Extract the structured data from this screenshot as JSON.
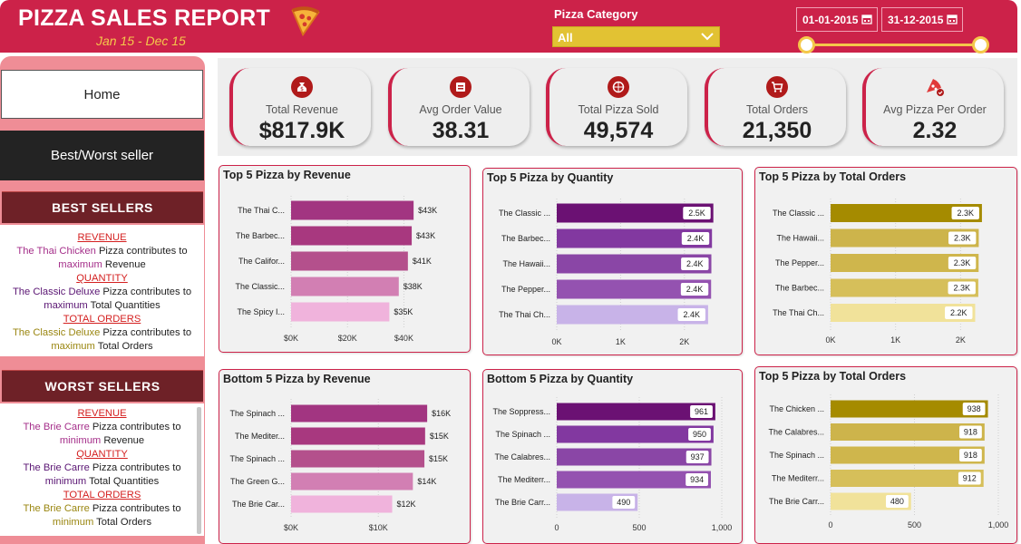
{
  "header": {
    "title": "PIZZA SALES REPORT",
    "subtitle": "Jan 15 - Dec 15",
    "category_label": "Pizza Category",
    "category_value": "All",
    "date_start": "01-01-2015",
    "date_end": "31-12-2015"
  },
  "nav": {
    "home": "Home",
    "best_worst": "Best/Worst seller"
  },
  "best": {
    "heading": "BEST SELLERS",
    "revenue_label": "REVENUE",
    "revenue_name": "The Thai Chicken",
    "revenue_tail": " Pizza contributes to",
    "revenue_l2_a": "maximum",
    "revenue_l2_b": " Revenue",
    "qty_label": "QUANTITY",
    "qty_name": "The Classic Deluxe",
    "qty_tail": " Pizza contributes to",
    "qty_l2_a": "maximum",
    "qty_l2_b": " Total Quantities",
    "orders_label": "TOTAL ORDERS",
    "orders_name": "The Classic Deluxe",
    "orders_tail": " Pizza contributes to",
    "orders_l2_a": "maximum",
    "orders_l2_b": " Total Orders"
  },
  "worst": {
    "heading": "WORST SELLERS",
    "revenue_label": "REVENUE",
    "revenue_name": "The Brie Carre",
    "revenue_tail": " Pizza contributes to",
    "revenue_l2_a": "minimum",
    "revenue_l2_b": " Revenue",
    "qty_label": "QUANTITY",
    "qty_name": "The Brie Carre",
    "qty_tail": "  Pizza contributes to",
    "qty_l2_a": "minimum",
    "qty_l2_b": " Total Quantities",
    "orders_label": "TOTAL ORDERS",
    "orders_name": "The Brie Carre",
    "orders_tail": " Pizza contributes to",
    "orders_l2_a": "minimum",
    "orders_l2_b": " Total Orders"
  },
  "kpis": [
    {
      "label": "Total Revenue",
      "value": "$817.9K",
      "icon": "money-bag-icon"
    },
    {
      "label": "Avg Order Value",
      "value": "38.31",
      "icon": "sale-tag-icon"
    },
    {
      "label": "Total Pizza Sold",
      "value": "49,574",
      "icon": "pizza-icon"
    },
    {
      "label": "Total Orders",
      "value": "21,350",
      "icon": "shopping-cart-icon"
    },
    {
      "label": "Avg Pizza Per Order",
      "value": "2.32",
      "icon": "pizza-slices-icon"
    }
  ],
  "colors": {
    "brand": "#cc2249",
    "revenue_palette": [
      "#a23581",
      "#a8387f",
      "#b4508c",
      "#d27fb3",
      "#f0b3dc"
    ],
    "quantity_palette": [
      "#6b1173",
      "#8238a0",
      "#8a46a6",
      "#9452b0",
      "#c8b3e8"
    ],
    "orders_palette": [
      "#a58b00",
      "#cdb44b",
      "#cfb64c",
      "#d6bf5a",
      "#f1e29a"
    ]
  },
  "chart_data": [
    {
      "type": "bar",
      "title": "Top 5 Pizza by Revenue",
      "categories": [
        "The Thai C...",
        "The Barbec...",
        "The Califor...",
        "The Classic...",
        "The Spicy I..."
      ],
      "values": [
        43434,
        42768,
        41410,
        38181,
        34831
      ],
      "labels": [
        "$43K",
        "$43K",
        "$41K",
        "$38K",
        "$35K"
      ],
      "xlim": [
        0,
        45000
      ],
      "ticks": [
        0,
        20000,
        40000
      ],
      "tick_labels": [
        "$0K",
        "$20K",
        "$40K"
      ],
      "palette": "revenue_palette",
      "label_style": "plain"
    },
    {
      "type": "bar",
      "title": "Top 5 Pizza by Quantity",
      "categories": [
        "The Classic ...",
        "The Barbec...",
        "The Hawaii...",
        "The Pepper...",
        "The Thai Ch..."
      ],
      "values": [
        2453,
        2432,
        2422,
        2418,
        2371
      ],
      "labels": [
        "2.5K",
        "2.4K",
        "2.4K",
        "2.4K",
        "2.4K"
      ],
      "xlim": [
        0,
        2500
      ],
      "ticks": [
        0,
        1000,
        2000
      ],
      "tick_labels": [
        "0K",
        "1K",
        "2K"
      ],
      "palette": "quantity_palette",
      "label_style": "boxed"
    },
    {
      "type": "bar",
      "title": "Top 5 Pizza by Total Orders",
      "categories": [
        "The Classic ...",
        "The Hawaii...",
        "The Pepper...",
        "The Barbec...",
        "The Thai Ch..."
      ],
      "values": [
        2329,
        2280,
        2278,
        2273,
        2225
      ],
      "labels": [
        "2.3K",
        "2.3K",
        "2.3K",
        "2.3K",
        "2.2K"
      ],
      "xlim": [
        0,
        2400
      ],
      "ticks": [
        0,
        1000,
        2000
      ],
      "tick_labels": [
        "0K",
        "1K",
        "2K"
      ],
      "palette": "orders_palette",
      "label_style": "boxed"
    },
    {
      "type": "bar",
      "title": "Bottom 5 Pizza by Revenue",
      "categories": [
        "The Spinach ...",
        "The Mediter...",
        "The Spinach ...",
        "The Green G...",
        "The Brie Car..."
      ],
      "values": [
        15596,
        15360,
        15277,
        13956,
        11588
      ],
      "labels": [
        "$16K",
        "$15K",
        "$15K",
        "$14K",
        "$12K"
      ],
      "xlim": [
        0,
        16000
      ],
      "ticks": [
        0,
        10000
      ],
      "tick_labels": [
        "$0K",
        "$10K"
      ],
      "palette": "revenue_palette",
      "label_style": "plain"
    },
    {
      "type": "bar",
      "title": "Bottom 5 Pizza by Quantity",
      "categories": [
        "The Soppress...",
        "The Spinach ...",
        "The Calabres...",
        "The Mediterr...",
        "The Brie Carr..."
      ],
      "values": [
        961,
        950,
        937,
        934,
        490
      ],
      "labels": [
        "961",
        "950",
        "937",
        "934",
        "490"
      ],
      "xlim": [
        0,
        1000
      ],
      "ticks": [
        0,
        500,
        1000
      ],
      "tick_labels": [
        "0",
        "500",
        "1,000"
      ],
      "palette": "quantity_palette",
      "label_style": "boxed"
    },
    {
      "type": "bar",
      "title": "Top 5 Pizza by Total Orders",
      "categories": [
        "The Chicken ...",
        "The Calabres...",
        "The Spinach ...",
        "The Mediterr...",
        "The Brie Carr..."
      ],
      "values": [
        938,
        918,
        918,
        912,
        480
      ],
      "labels": [
        "938",
        "918",
        "918",
        "912",
        "480"
      ],
      "xlim": [
        0,
        1000
      ],
      "ticks": [
        0,
        500,
        1000
      ],
      "tick_labels": [
        "0",
        "500",
        "1,000"
      ],
      "palette": "orders_palette",
      "label_style": "boxed"
    }
  ]
}
